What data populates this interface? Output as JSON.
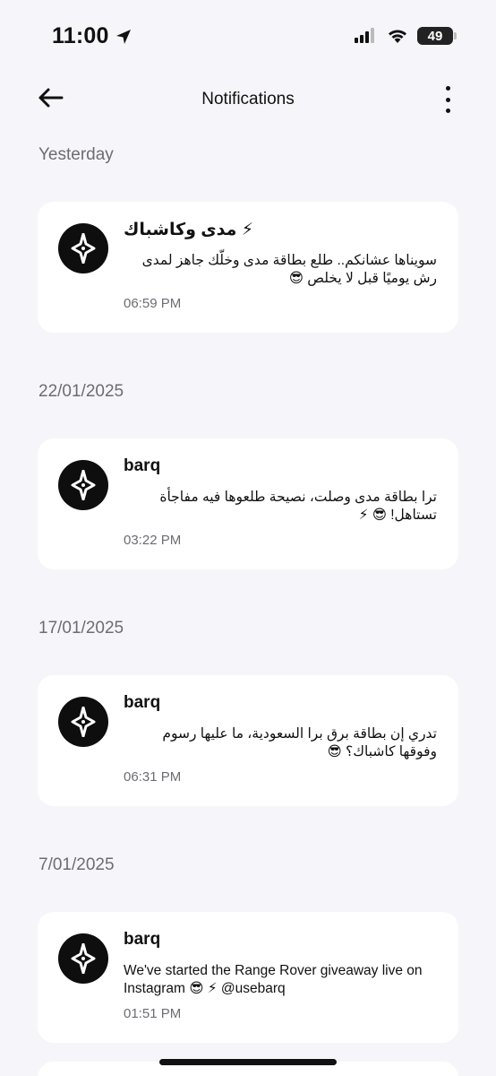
{
  "status_bar": {
    "time": "11:00",
    "battery": "49"
  },
  "header": {
    "title": "Notifications"
  },
  "sections": [
    {
      "label": "Yesterday",
      "notification": {
        "title": "⚡ مدى وكاشباك",
        "body": "سويناها عشانكم.. طلع بطاقة مدى وخلّك جاهز لمدى رش يوميًا قبل لا يخلص 😎",
        "time": "06:59 PM"
      }
    },
    {
      "label": "22/01/2025",
      "notification": {
        "title": "barq",
        "body": "ترا بطاقة مدى وصلت، نصيحة طلعوها فيه مفاجأة تستاهل! 😎 ⚡",
        "time": "03:22 PM"
      }
    },
    {
      "label": "17/01/2025",
      "notification": {
        "title": "barq",
        "body": "تدري إن بطاقة برق برا السعودية، ما عليها رسوم وفوقها كاشباك؟ 😎",
        "time": "06:31 PM"
      }
    },
    {
      "label": "7/01/2025",
      "notification": {
        "title": "barq",
        "body": "We've started the Range Rover giveaway live on Instagram 😎 ⚡ @usebarq",
        "time": "01:51 PM"
      }
    }
  ]
}
